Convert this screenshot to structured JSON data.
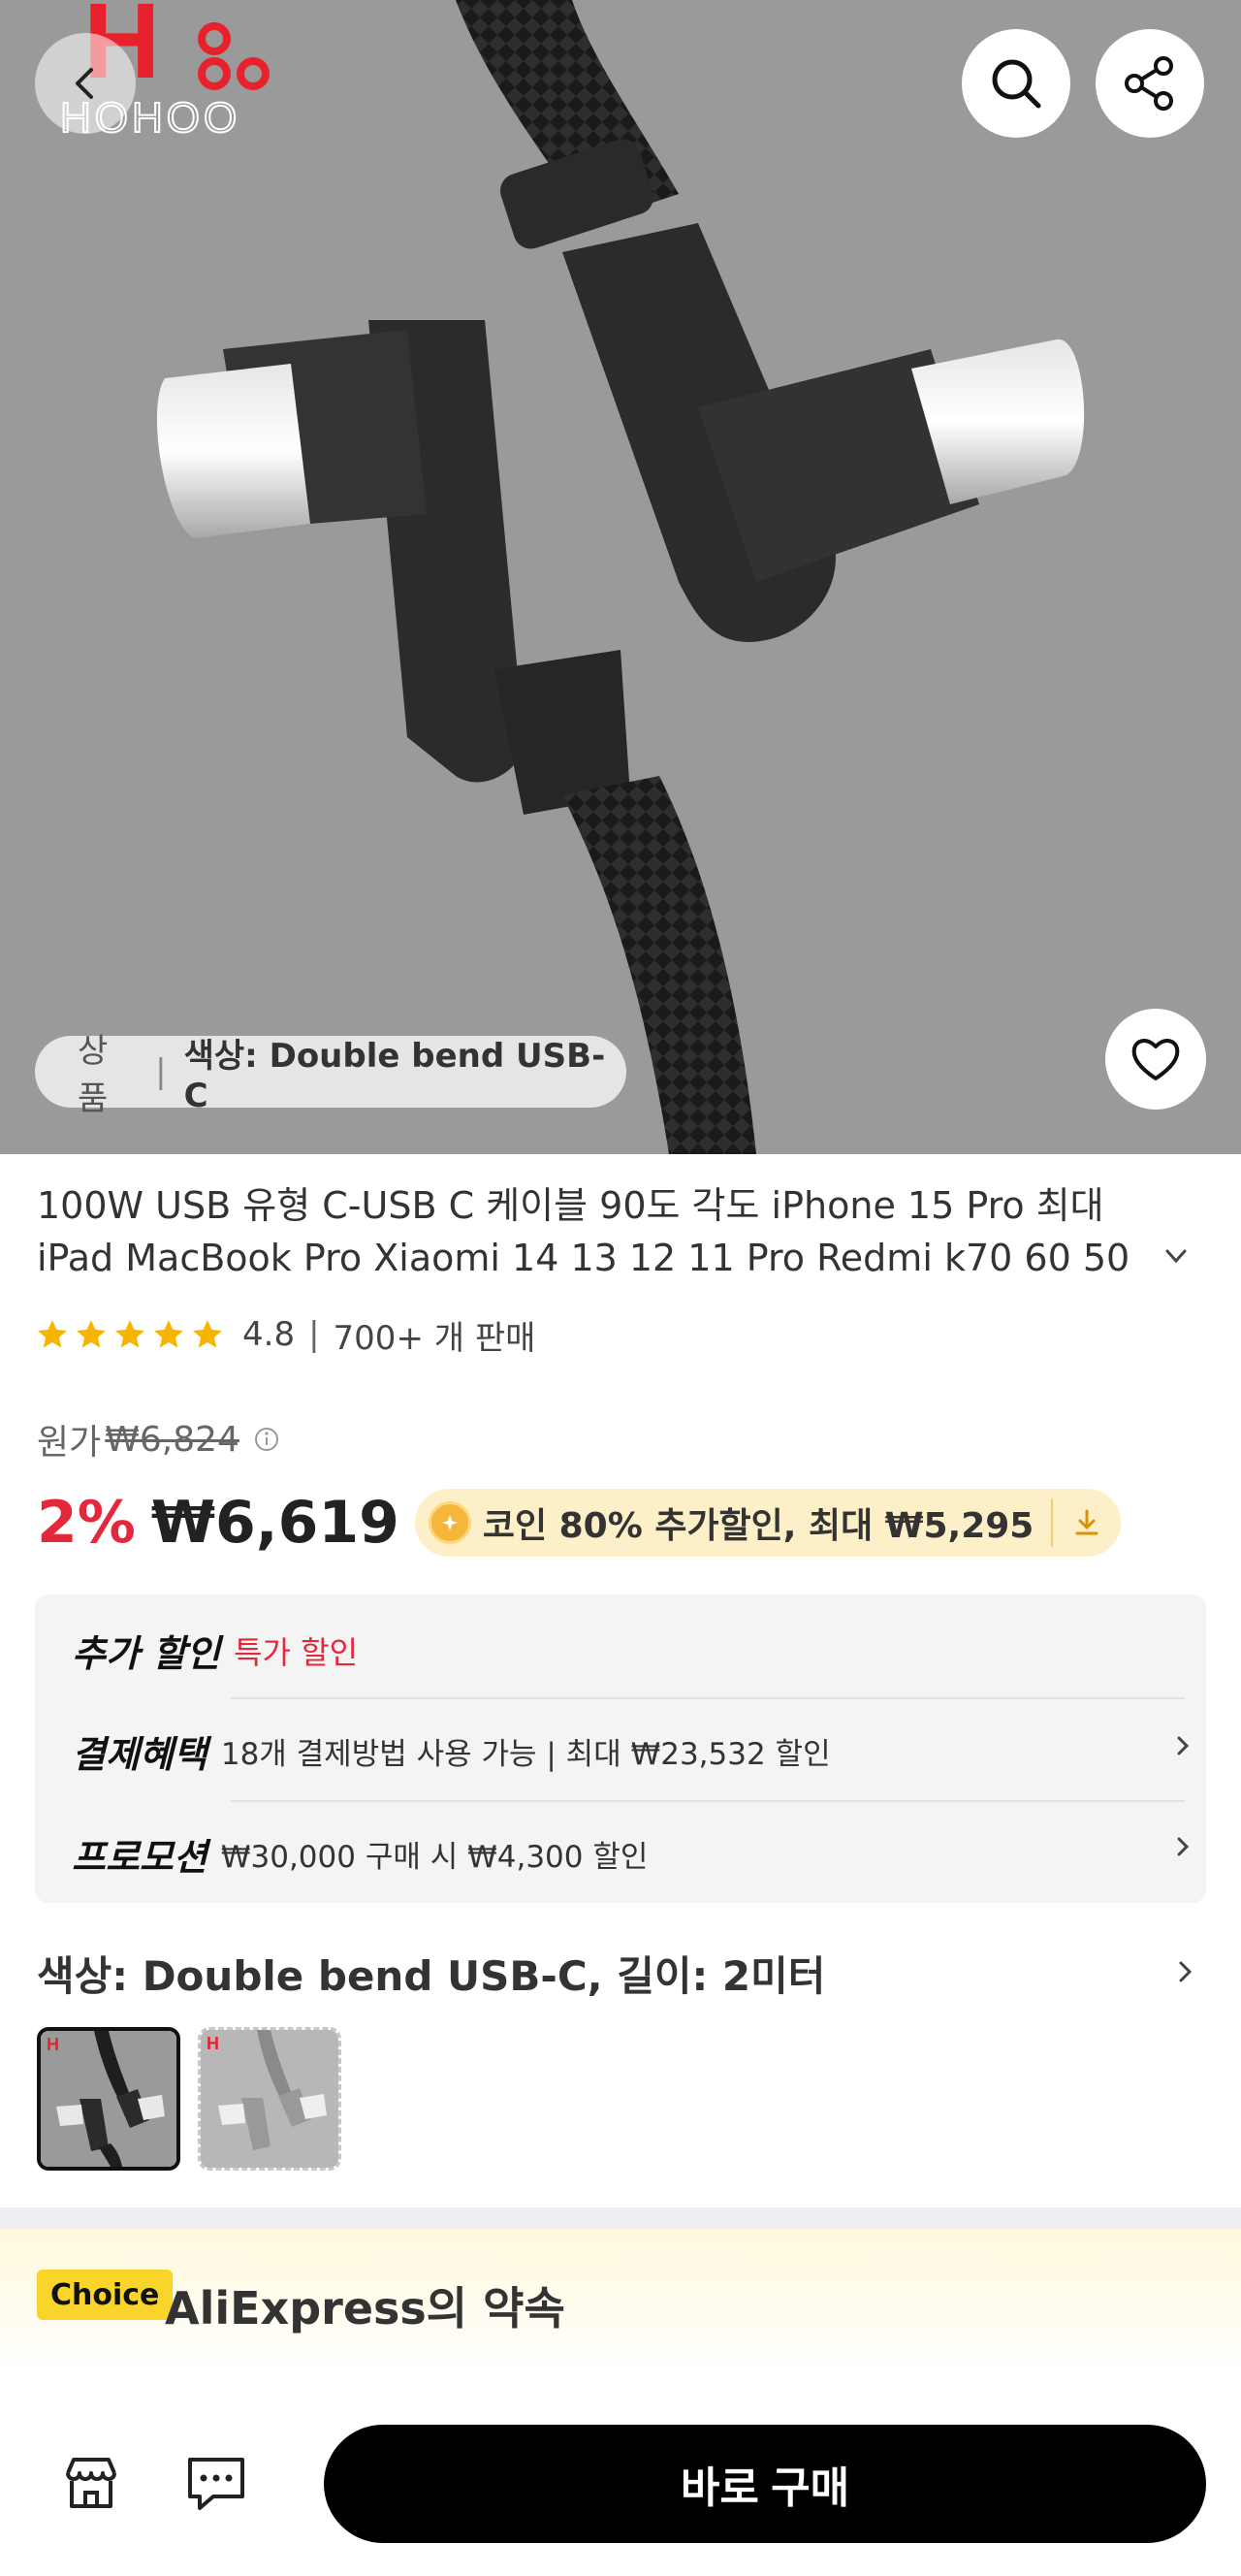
{
  "header": {
    "brand_logo_text": "HOHOO",
    "back_icon": "chevron-left-icon",
    "search_icon": "search-icon",
    "share_icon": "share-icon"
  },
  "gallery": {
    "tag_prefix": "상품",
    "tag_separator": "|",
    "tag_value": "색상: Double bend USB-C",
    "wishlist_icon": "heart-icon"
  },
  "product": {
    "title_line1": "100W USB 유형 C-USB C 케이블 90도 각도 iPhone 15 Pro 최대",
    "title_line2": "iPad MacBook Pro Xiaomi 14 13 12 11 Pro Redmi k70 60 50",
    "rating": "4.8",
    "rating_stars": 5,
    "sold": "700+ 개 판매"
  },
  "pricing": {
    "original_label": "원가",
    "original_price": "₩6,824",
    "discount_percent": "2%",
    "price": "₩6,619",
    "coin_text": "코인 80% 추가할인, 최대 ₩5,295"
  },
  "promotions": {
    "extra_label": "추가 할인",
    "extra_value": "특가 할인",
    "payment_label": "결제혜택",
    "payment_value": "18개 결제방법 사용 가능 | 최대 ₩23,532 할인",
    "promo_label": "프로모션",
    "promo_value": "₩30,000 구매 시 ₩4,300 할인"
  },
  "variant": {
    "title": "색상: Double bend USB-C, 길이: 2미터"
  },
  "choice": {
    "badge": "Choice",
    "title": "AliExpress의 약속"
  },
  "bottom_bar": {
    "store_icon": "store-icon",
    "chat_icon": "chat-icon",
    "buy_label": "바로 구매"
  },
  "colors": {
    "accent_red": "#e4283c",
    "choice_yellow": "#f9d42a",
    "coin_bg": "#fdf0c8",
    "buy_button": "#000000"
  }
}
